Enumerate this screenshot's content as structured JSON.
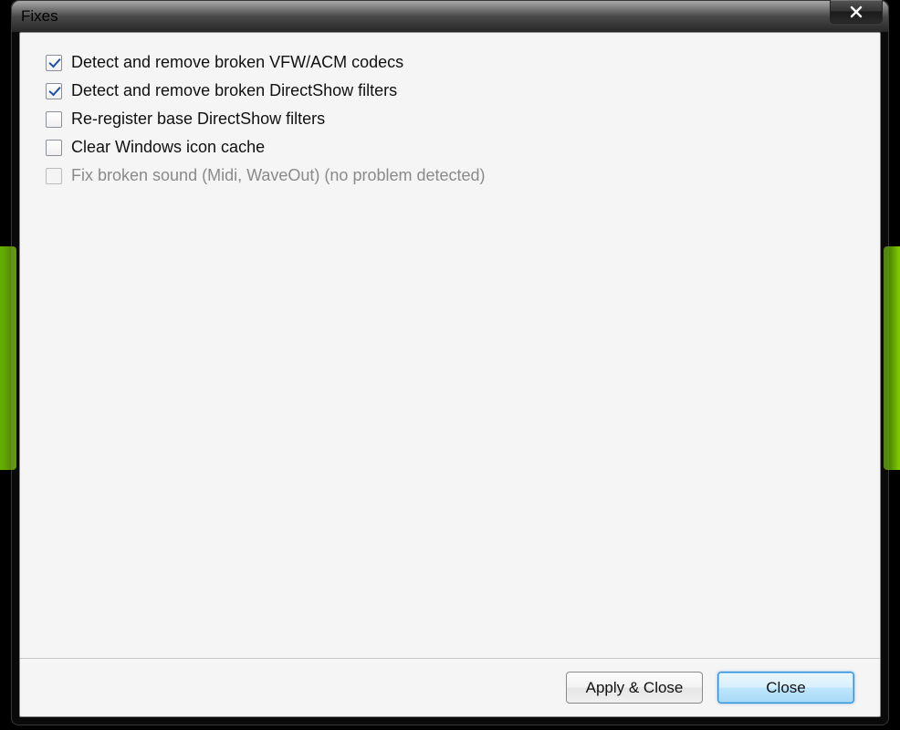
{
  "window": {
    "title": "Fixes"
  },
  "options": [
    {
      "label": "Detect and remove broken VFW/ACM codecs",
      "checked": true,
      "disabled": false
    },
    {
      "label": "Detect and remove broken DirectShow filters",
      "checked": true,
      "disabled": false
    },
    {
      "label": "Re-register base DirectShow filters",
      "checked": false,
      "disabled": false
    },
    {
      "label": "Clear Windows icon cache",
      "checked": false,
      "disabled": false
    },
    {
      "label": "Fix broken sound (Midi, WaveOut)  (no problem detected)",
      "checked": false,
      "disabled": true
    }
  ],
  "footer": {
    "apply_label": "Apply & Close",
    "close_label": "Close"
  }
}
